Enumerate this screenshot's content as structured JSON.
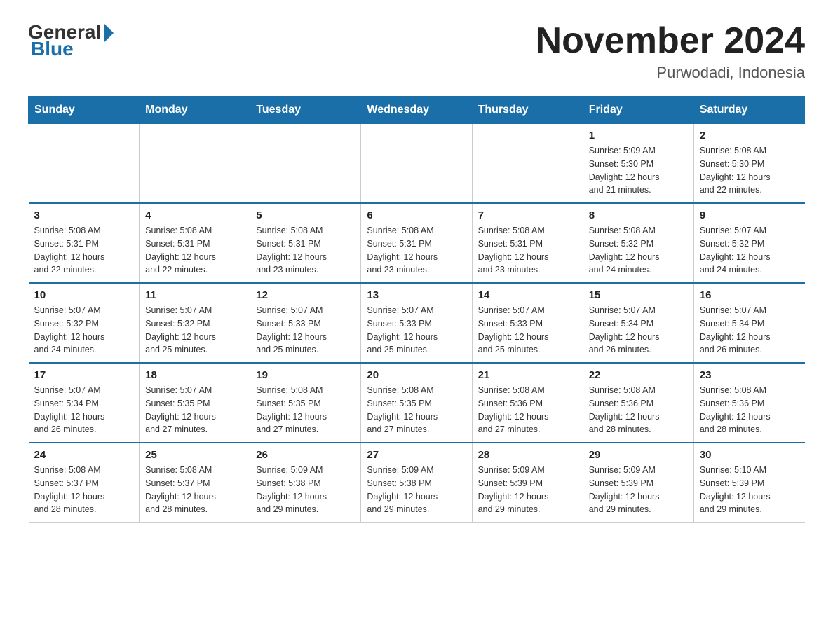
{
  "logo": {
    "general": "General",
    "blue": "Blue"
  },
  "title": "November 2024",
  "location": "Purwodadi, Indonesia",
  "weekdays": [
    "Sunday",
    "Monday",
    "Tuesday",
    "Wednesday",
    "Thursday",
    "Friday",
    "Saturday"
  ],
  "rows": [
    [
      {
        "day": "",
        "info": ""
      },
      {
        "day": "",
        "info": ""
      },
      {
        "day": "",
        "info": ""
      },
      {
        "day": "",
        "info": ""
      },
      {
        "day": "",
        "info": ""
      },
      {
        "day": "1",
        "info": "Sunrise: 5:09 AM\nSunset: 5:30 PM\nDaylight: 12 hours\nand 21 minutes."
      },
      {
        "day": "2",
        "info": "Sunrise: 5:08 AM\nSunset: 5:30 PM\nDaylight: 12 hours\nand 22 minutes."
      }
    ],
    [
      {
        "day": "3",
        "info": "Sunrise: 5:08 AM\nSunset: 5:31 PM\nDaylight: 12 hours\nand 22 minutes."
      },
      {
        "day": "4",
        "info": "Sunrise: 5:08 AM\nSunset: 5:31 PM\nDaylight: 12 hours\nand 22 minutes."
      },
      {
        "day": "5",
        "info": "Sunrise: 5:08 AM\nSunset: 5:31 PM\nDaylight: 12 hours\nand 23 minutes."
      },
      {
        "day": "6",
        "info": "Sunrise: 5:08 AM\nSunset: 5:31 PM\nDaylight: 12 hours\nand 23 minutes."
      },
      {
        "day": "7",
        "info": "Sunrise: 5:08 AM\nSunset: 5:31 PM\nDaylight: 12 hours\nand 23 minutes."
      },
      {
        "day": "8",
        "info": "Sunrise: 5:08 AM\nSunset: 5:32 PM\nDaylight: 12 hours\nand 24 minutes."
      },
      {
        "day": "9",
        "info": "Sunrise: 5:07 AM\nSunset: 5:32 PM\nDaylight: 12 hours\nand 24 minutes."
      }
    ],
    [
      {
        "day": "10",
        "info": "Sunrise: 5:07 AM\nSunset: 5:32 PM\nDaylight: 12 hours\nand 24 minutes."
      },
      {
        "day": "11",
        "info": "Sunrise: 5:07 AM\nSunset: 5:32 PM\nDaylight: 12 hours\nand 25 minutes."
      },
      {
        "day": "12",
        "info": "Sunrise: 5:07 AM\nSunset: 5:33 PM\nDaylight: 12 hours\nand 25 minutes."
      },
      {
        "day": "13",
        "info": "Sunrise: 5:07 AM\nSunset: 5:33 PM\nDaylight: 12 hours\nand 25 minutes."
      },
      {
        "day": "14",
        "info": "Sunrise: 5:07 AM\nSunset: 5:33 PM\nDaylight: 12 hours\nand 25 minutes."
      },
      {
        "day": "15",
        "info": "Sunrise: 5:07 AM\nSunset: 5:34 PM\nDaylight: 12 hours\nand 26 minutes."
      },
      {
        "day": "16",
        "info": "Sunrise: 5:07 AM\nSunset: 5:34 PM\nDaylight: 12 hours\nand 26 minutes."
      }
    ],
    [
      {
        "day": "17",
        "info": "Sunrise: 5:07 AM\nSunset: 5:34 PM\nDaylight: 12 hours\nand 26 minutes."
      },
      {
        "day": "18",
        "info": "Sunrise: 5:07 AM\nSunset: 5:35 PM\nDaylight: 12 hours\nand 27 minutes."
      },
      {
        "day": "19",
        "info": "Sunrise: 5:08 AM\nSunset: 5:35 PM\nDaylight: 12 hours\nand 27 minutes."
      },
      {
        "day": "20",
        "info": "Sunrise: 5:08 AM\nSunset: 5:35 PM\nDaylight: 12 hours\nand 27 minutes."
      },
      {
        "day": "21",
        "info": "Sunrise: 5:08 AM\nSunset: 5:36 PM\nDaylight: 12 hours\nand 27 minutes."
      },
      {
        "day": "22",
        "info": "Sunrise: 5:08 AM\nSunset: 5:36 PM\nDaylight: 12 hours\nand 28 minutes."
      },
      {
        "day": "23",
        "info": "Sunrise: 5:08 AM\nSunset: 5:36 PM\nDaylight: 12 hours\nand 28 minutes."
      }
    ],
    [
      {
        "day": "24",
        "info": "Sunrise: 5:08 AM\nSunset: 5:37 PM\nDaylight: 12 hours\nand 28 minutes."
      },
      {
        "day": "25",
        "info": "Sunrise: 5:08 AM\nSunset: 5:37 PM\nDaylight: 12 hours\nand 28 minutes."
      },
      {
        "day": "26",
        "info": "Sunrise: 5:09 AM\nSunset: 5:38 PM\nDaylight: 12 hours\nand 29 minutes."
      },
      {
        "day": "27",
        "info": "Sunrise: 5:09 AM\nSunset: 5:38 PM\nDaylight: 12 hours\nand 29 minutes."
      },
      {
        "day": "28",
        "info": "Sunrise: 5:09 AM\nSunset: 5:39 PM\nDaylight: 12 hours\nand 29 minutes."
      },
      {
        "day": "29",
        "info": "Sunrise: 5:09 AM\nSunset: 5:39 PM\nDaylight: 12 hours\nand 29 minutes."
      },
      {
        "day": "30",
        "info": "Sunrise: 5:10 AM\nSunset: 5:39 PM\nDaylight: 12 hours\nand 29 minutes."
      }
    ]
  ]
}
